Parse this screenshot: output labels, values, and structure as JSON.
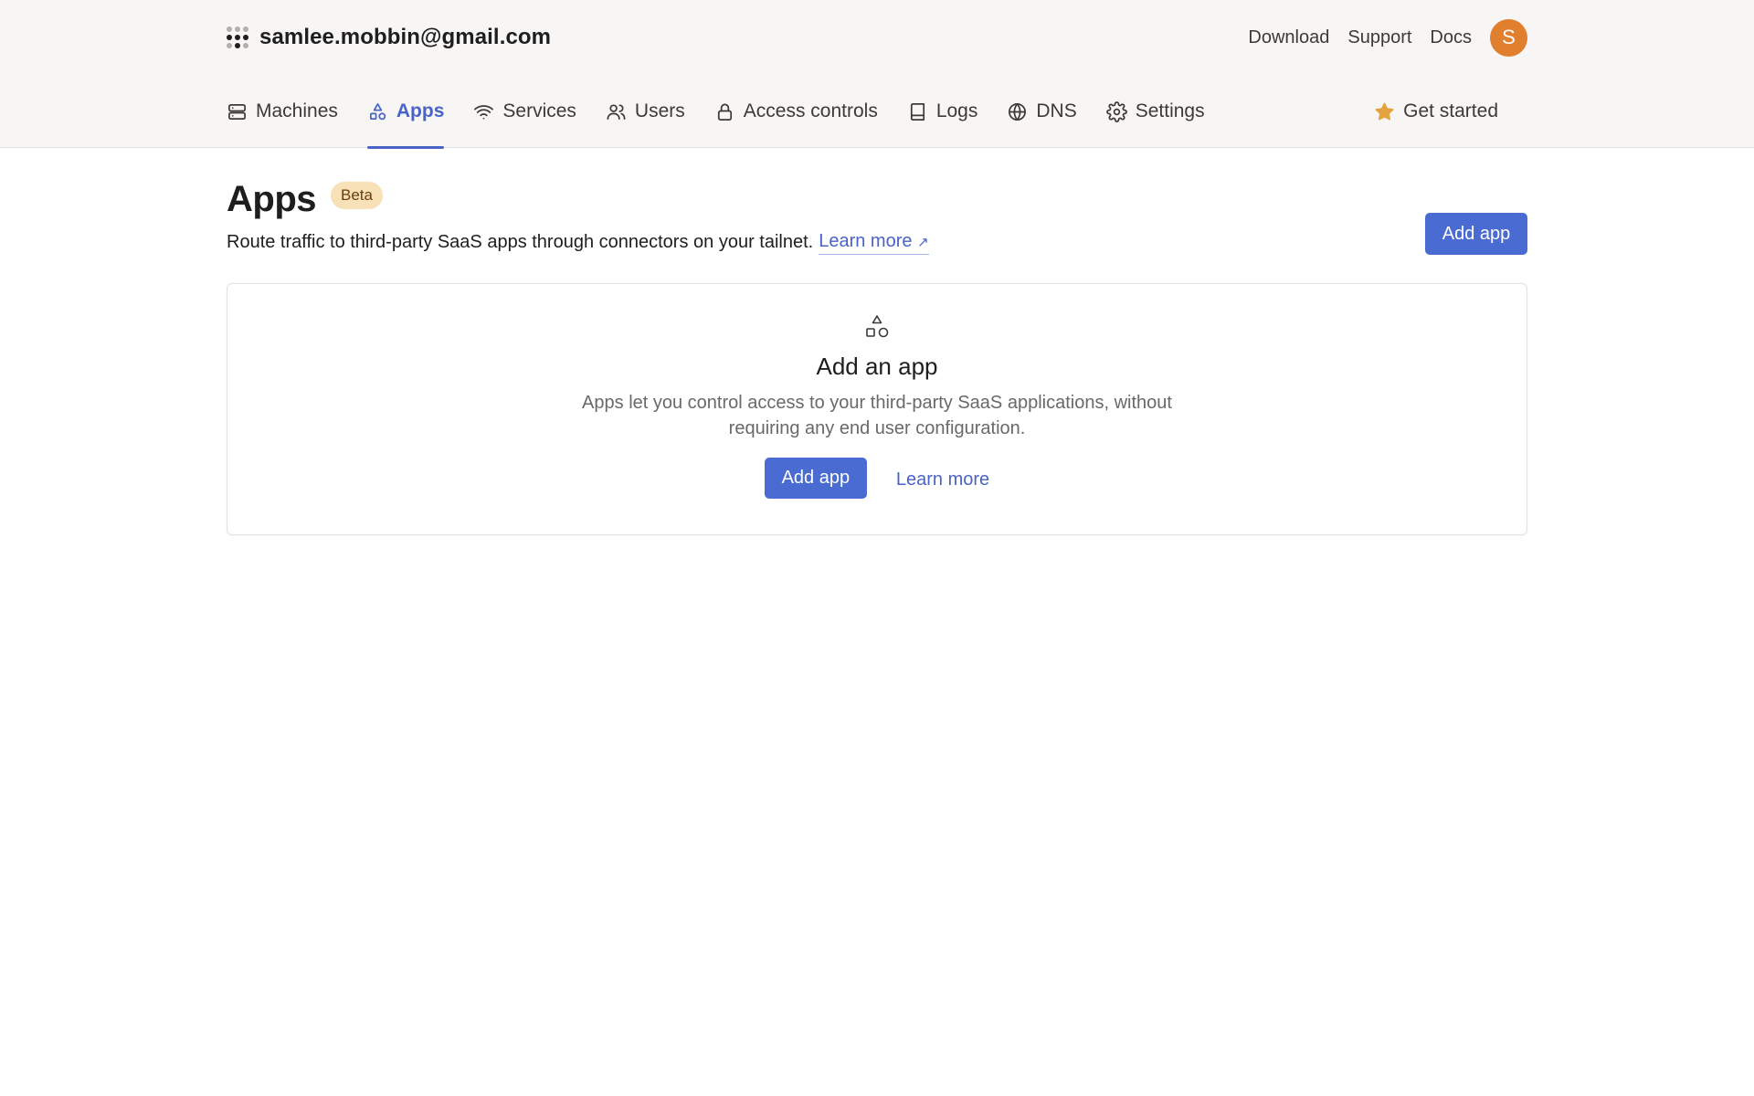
{
  "account": {
    "name": "samlee.mobbin@gmail.com"
  },
  "toplinks": {
    "download": "Download",
    "support": "Support",
    "docs": "Docs",
    "avatar_letter": "S"
  },
  "tabs": [
    {
      "label": "Machines",
      "icon": "machines-icon"
    },
    {
      "label": "Apps",
      "icon": "apps-icon",
      "active": true
    },
    {
      "label": "Services",
      "icon": "services-icon"
    },
    {
      "label": "Users",
      "icon": "users-icon"
    },
    {
      "label": "Access controls",
      "icon": "lock-icon"
    },
    {
      "label": "Logs",
      "icon": "book-icon"
    },
    {
      "label": "DNS",
      "icon": "globe-icon"
    },
    {
      "label": "Settings",
      "icon": "gear-icon"
    }
  ],
  "get_started": {
    "label": "Get started",
    "icon": "star-icon"
  },
  "page": {
    "title": "Apps",
    "badge": "Beta",
    "description": "Route traffic to third-party SaaS apps through connectors on your tailnet.",
    "learn_more": "Learn more",
    "learn_more_arrow": "↗",
    "add_app": "Add app"
  },
  "empty_state": {
    "icon": "shapes-icon",
    "title": "Add an app",
    "description": "Apps let you control access to your third-party SaaS applications, without requiring any end user configuration.",
    "add_app": "Add app",
    "learn_more": "Learn more"
  },
  "colors": {
    "accent": "#4a63c7",
    "button": "#4a6bd1",
    "avatar": "#e07f2e",
    "badge_bg": "#f8e1b6"
  }
}
